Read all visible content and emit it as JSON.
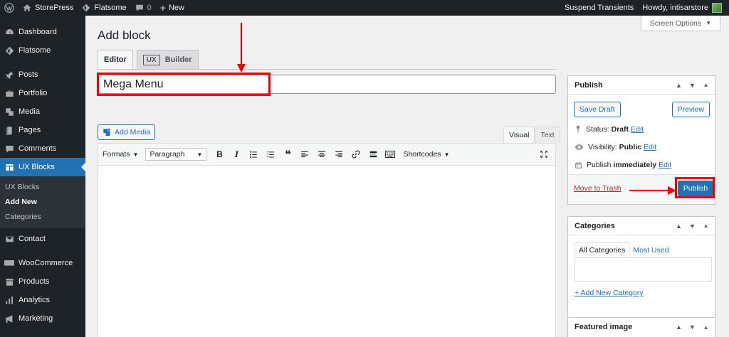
{
  "adminbar": {
    "site_name": "StorePress",
    "theme_name": "Flatsome",
    "comments_count": "0",
    "new_label": "New",
    "suspend": "Suspend Transients",
    "howdy": "Howdy, intisarstore"
  },
  "sidebar": {
    "items": [
      {
        "label": "Dashboard",
        "icon": "dashboard-icon"
      },
      {
        "label": "Flatsome",
        "icon": "flatsome-icon"
      },
      {
        "label": "Posts",
        "icon": "pin-icon"
      },
      {
        "label": "Portfolio",
        "icon": "portfolio-icon"
      },
      {
        "label": "Media",
        "icon": "media-icon"
      },
      {
        "label": "Pages",
        "icon": "pages-icon"
      },
      {
        "label": "Comments",
        "icon": "comment-icon"
      },
      {
        "label": "UX Blocks",
        "icon": "blocks-icon"
      },
      {
        "label": "Contact",
        "icon": "mail-icon"
      },
      {
        "label": "WooCommerce",
        "icon": "woo-icon"
      },
      {
        "label": "Products",
        "icon": "archive-icon"
      },
      {
        "label": "Analytics",
        "icon": "chart-icon"
      },
      {
        "label": "Marketing",
        "icon": "megaphone-icon"
      }
    ],
    "submenu": [
      "UX Blocks",
      "Add New",
      "Categories"
    ]
  },
  "main": {
    "screen_options": "Screen Options",
    "title": "Add block",
    "tabs": {
      "editor": "Editor",
      "ux": "UX",
      "builder": "Builder"
    },
    "post_title": "Mega Menu",
    "add_media": "Add Media",
    "visual": "Visual",
    "text": "Text",
    "toolbar": {
      "formats": "Formats",
      "paragraph": "Paragraph",
      "bold": "B",
      "italic": "I",
      "shortcodes": "Shortcodes"
    }
  },
  "publish": {
    "heading": "Publish",
    "save_draft": "Save Draft",
    "preview": "Preview",
    "status_label": "Status:",
    "status_value": "Draft",
    "visibility_label": "Visibility:",
    "visibility_value": "Public",
    "publish_label": "Publish",
    "publish_value": "immediately",
    "edit": "Edit",
    "trash": "Move to Trash",
    "publish_button": "Publish"
  },
  "categories": {
    "heading": "Categories",
    "tab_all": "All Categories",
    "tab_used": "Most Used",
    "add_new": "+ Add New Category"
  },
  "featured": {
    "heading": "Featured image"
  },
  "colors": {
    "accent": "#2271b1",
    "highlight": "#e00000",
    "adminbar": "#1d2327"
  }
}
